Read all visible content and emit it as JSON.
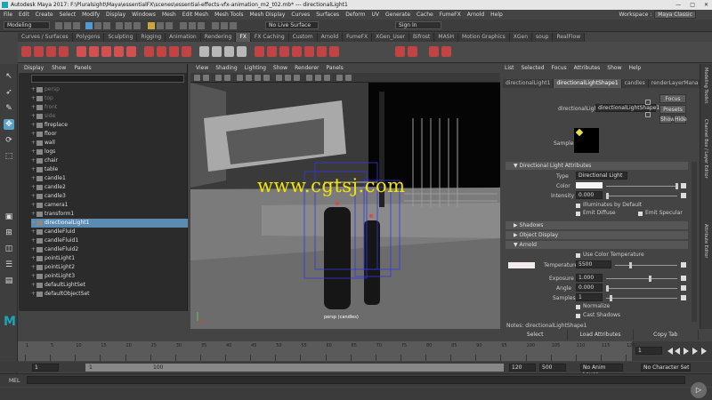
{
  "window": {
    "title": "Autodesk Maya 2017: F:\\Pluralsight\\Maya\\essentialFX\\scenes\\essential-effects-vfx-animation_m2_t02.mb*  ---  directionalLight1",
    "minimize": "—",
    "maximize": "□",
    "close": "✕"
  },
  "menu": [
    "File",
    "Edit",
    "Create",
    "Select",
    "Modify",
    "Display",
    "Windows",
    "Mesh",
    "Edit Mesh",
    "Mesh Tools",
    "Mesh Display",
    "Curves",
    "Surfaces",
    "Deform",
    "UV",
    "Generate",
    "Cache",
    "FumeFX",
    "Arnold",
    "Help"
  ],
  "workspace": {
    "label": "Workspace :",
    "value": "Maya Classic"
  },
  "status": {
    "mode": "Modeling",
    "live": "No Live Surface",
    "signin": "Sign In"
  },
  "shelf_tabs": [
    "Curves / Surfaces",
    "Polygons",
    "Sculpting",
    "Rigging",
    "Animation",
    "Rendering",
    "FX",
    "FX Caching",
    "Custom",
    "Arnold",
    "FumeFX",
    "XGen_User",
    "Bifrost",
    "MASH",
    "Motion Graphics",
    "XGen",
    "soup",
    "RealFlow"
  ],
  "shelf_active": "FX",
  "outliner": {
    "menu": [
      "Display",
      "Show",
      "Panels"
    ],
    "search_placeholder": "",
    "items": [
      {
        "name": "persp",
        "dim": true
      },
      {
        "name": "top",
        "dim": true
      },
      {
        "name": "front",
        "dim": true
      },
      {
        "name": "side",
        "dim": true
      },
      {
        "name": "fireplace"
      },
      {
        "name": "floor"
      },
      {
        "name": "wall"
      },
      {
        "name": "logs"
      },
      {
        "name": "chair"
      },
      {
        "name": "table"
      },
      {
        "name": "candle1"
      },
      {
        "name": "candle2"
      },
      {
        "name": "candle3"
      },
      {
        "name": "camera1"
      },
      {
        "name": "transform1"
      },
      {
        "name": "directionalLight1",
        "selected": true
      },
      {
        "name": "candleFluid"
      },
      {
        "name": "candleFluid1"
      },
      {
        "name": "candleFluid2"
      },
      {
        "name": "pointLight1"
      },
      {
        "name": "pointLight2"
      },
      {
        "name": "pointLight3"
      },
      {
        "name": "defaultLightSet"
      },
      {
        "name": "defaultObjectSet"
      }
    ]
  },
  "viewport": {
    "menu": [
      "View",
      "Shading",
      "Lighting",
      "Show",
      "Renderer",
      "Panels"
    ],
    "camera_label": "persp (candles)",
    "watermark": "www.cgtsj.com"
  },
  "attribute_editor": {
    "menu": [
      "List",
      "Selected",
      "Focus",
      "Attributes",
      "Show",
      "Help"
    ],
    "tabs": [
      "directionalLight1",
      "directionalLightShape1",
      "candles",
      "renderLayerMana"
    ],
    "active_tab": "directionalLightShape1",
    "node_label": "directionalLight:",
    "node_value": "directionalLightShape1",
    "focus": "Focus",
    "presets": "Presets",
    "show": "Show",
    "hide": "Hide",
    "sample_label": "Sample",
    "sections": {
      "dla": "Directional Light Attributes",
      "shadows": "Shadows",
      "object_display": "Object Display",
      "arnold": "Arnold"
    },
    "type_label": "Type",
    "type_value": "Directional Light",
    "color_label": "Color",
    "intensity_label": "Intensity",
    "intensity_value": "0.000",
    "illuminates": "Illuminates by Default",
    "emit_diffuse": "Emit Diffuse",
    "emit_specular": "Emit Specular",
    "use_color_temp": "Use Color Temperature",
    "temperature_label": "Temperature",
    "temperature_value": "5500",
    "exposure_label": "Exposure",
    "exposure_value": "1.000",
    "angle_label": "Angle",
    "angle_value": "0.000",
    "samples_label": "Samples",
    "samples_value": "1",
    "normalize": "Normalize",
    "cast_shadows": "Cast Shadows",
    "notes": "Notes:  directionalLightShape1",
    "bottom_buttons": [
      "Select",
      "Load Attributes",
      "Copy Tab"
    ]
  },
  "side_tabs": [
    "Modeling Toolkit",
    "Channel Box / Layer Editor",
    "Attribute Editor"
  ],
  "timeline": {
    "ticks": [
      "1",
      "5",
      "10",
      "15",
      "20",
      "25",
      "30",
      "35",
      "40",
      "45",
      "50",
      "55",
      "60",
      "65",
      "70",
      "75",
      "80",
      "85",
      "90",
      "95",
      "100",
      "105",
      "110",
      "115",
      "120"
    ],
    "current": "1"
  },
  "range": {
    "start": "1",
    "inner_start": "1",
    "inner_end": "100",
    "end_inner": "120",
    "end": "500",
    "anim_layer": "No Anim Layer",
    "char_set": "No Character Set"
  },
  "cmdline": {
    "label": "MEL"
  }
}
